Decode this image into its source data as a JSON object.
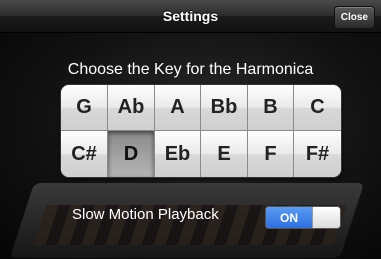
{
  "navbar": {
    "title": "Settings",
    "close_label": "Close"
  },
  "settings": {
    "heading": "Choose the Key for the Harmonica",
    "keys_row1": [
      "G",
      "Ab",
      "A",
      "Bb",
      "B",
      "C"
    ],
    "keys_row2": [
      "C#",
      "D",
      "Eb",
      "E",
      "F",
      "F#"
    ],
    "selected_key": "D",
    "slow_motion_label": "Slow Motion Playback",
    "slow_motion_value": "ON"
  },
  "colors": {
    "toggle_on": "#2d6fe0",
    "background": "#0b0b0b"
  }
}
